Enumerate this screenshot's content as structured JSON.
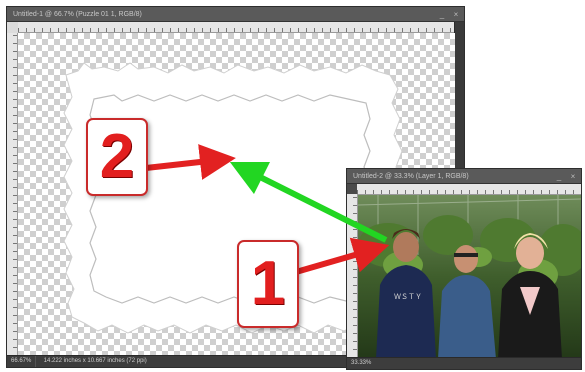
{
  "back_window": {
    "title": "Untitled-1 @ 66.7% (Puzzle 01 1, RGB/8)",
    "zoom": "66.67%",
    "doc_info": "14.222 inches x 10.667 inches (72 ppi)"
  },
  "front_window": {
    "title": "Untitled-2 @ 33.3% (Layer 1, RGB/8)",
    "zoom": "33.33%"
  },
  "window_controls": {
    "minimize": "_",
    "close": "×"
  },
  "callouts": {
    "one": "1",
    "two": "2"
  },
  "colors": {
    "red_arrow": "#e22121",
    "green_arrow": "#22d622",
    "callout_border": "#c92b2b"
  },
  "icons": {
    "minimize": "minimize-icon",
    "close": "close-icon"
  }
}
